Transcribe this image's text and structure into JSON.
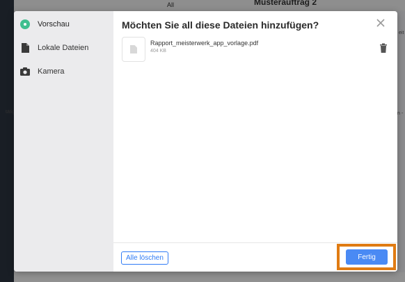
{
  "background": {
    "title": "Musterauftrag 2",
    "tab_label": "All",
    "side_fragment_left": "tätig",
    "side_fragment_right": "n -",
    "side_fragment_top": "eit"
  },
  "sidebar": {
    "items": [
      {
        "label": "Vorschau",
        "icon": "preview-dot-icon"
      },
      {
        "label": "Lokale Dateien",
        "icon": "file-icon"
      },
      {
        "label": "Kamera",
        "icon": "camera-icon"
      }
    ]
  },
  "main": {
    "title": "Möchten Sie all diese Dateien hinzufügen?",
    "files": [
      {
        "name": "Rapport_meisterwerk_app_vorlage.pdf",
        "size": "404 KB"
      }
    ]
  },
  "footer": {
    "clear_label": "Alle löschen",
    "done_label": "Fertig"
  },
  "colors": {
    "accent": "#4a8af4",
    "highlight": "#e07b12",
    "active_dot": "#3fbf8f"
  }
}
